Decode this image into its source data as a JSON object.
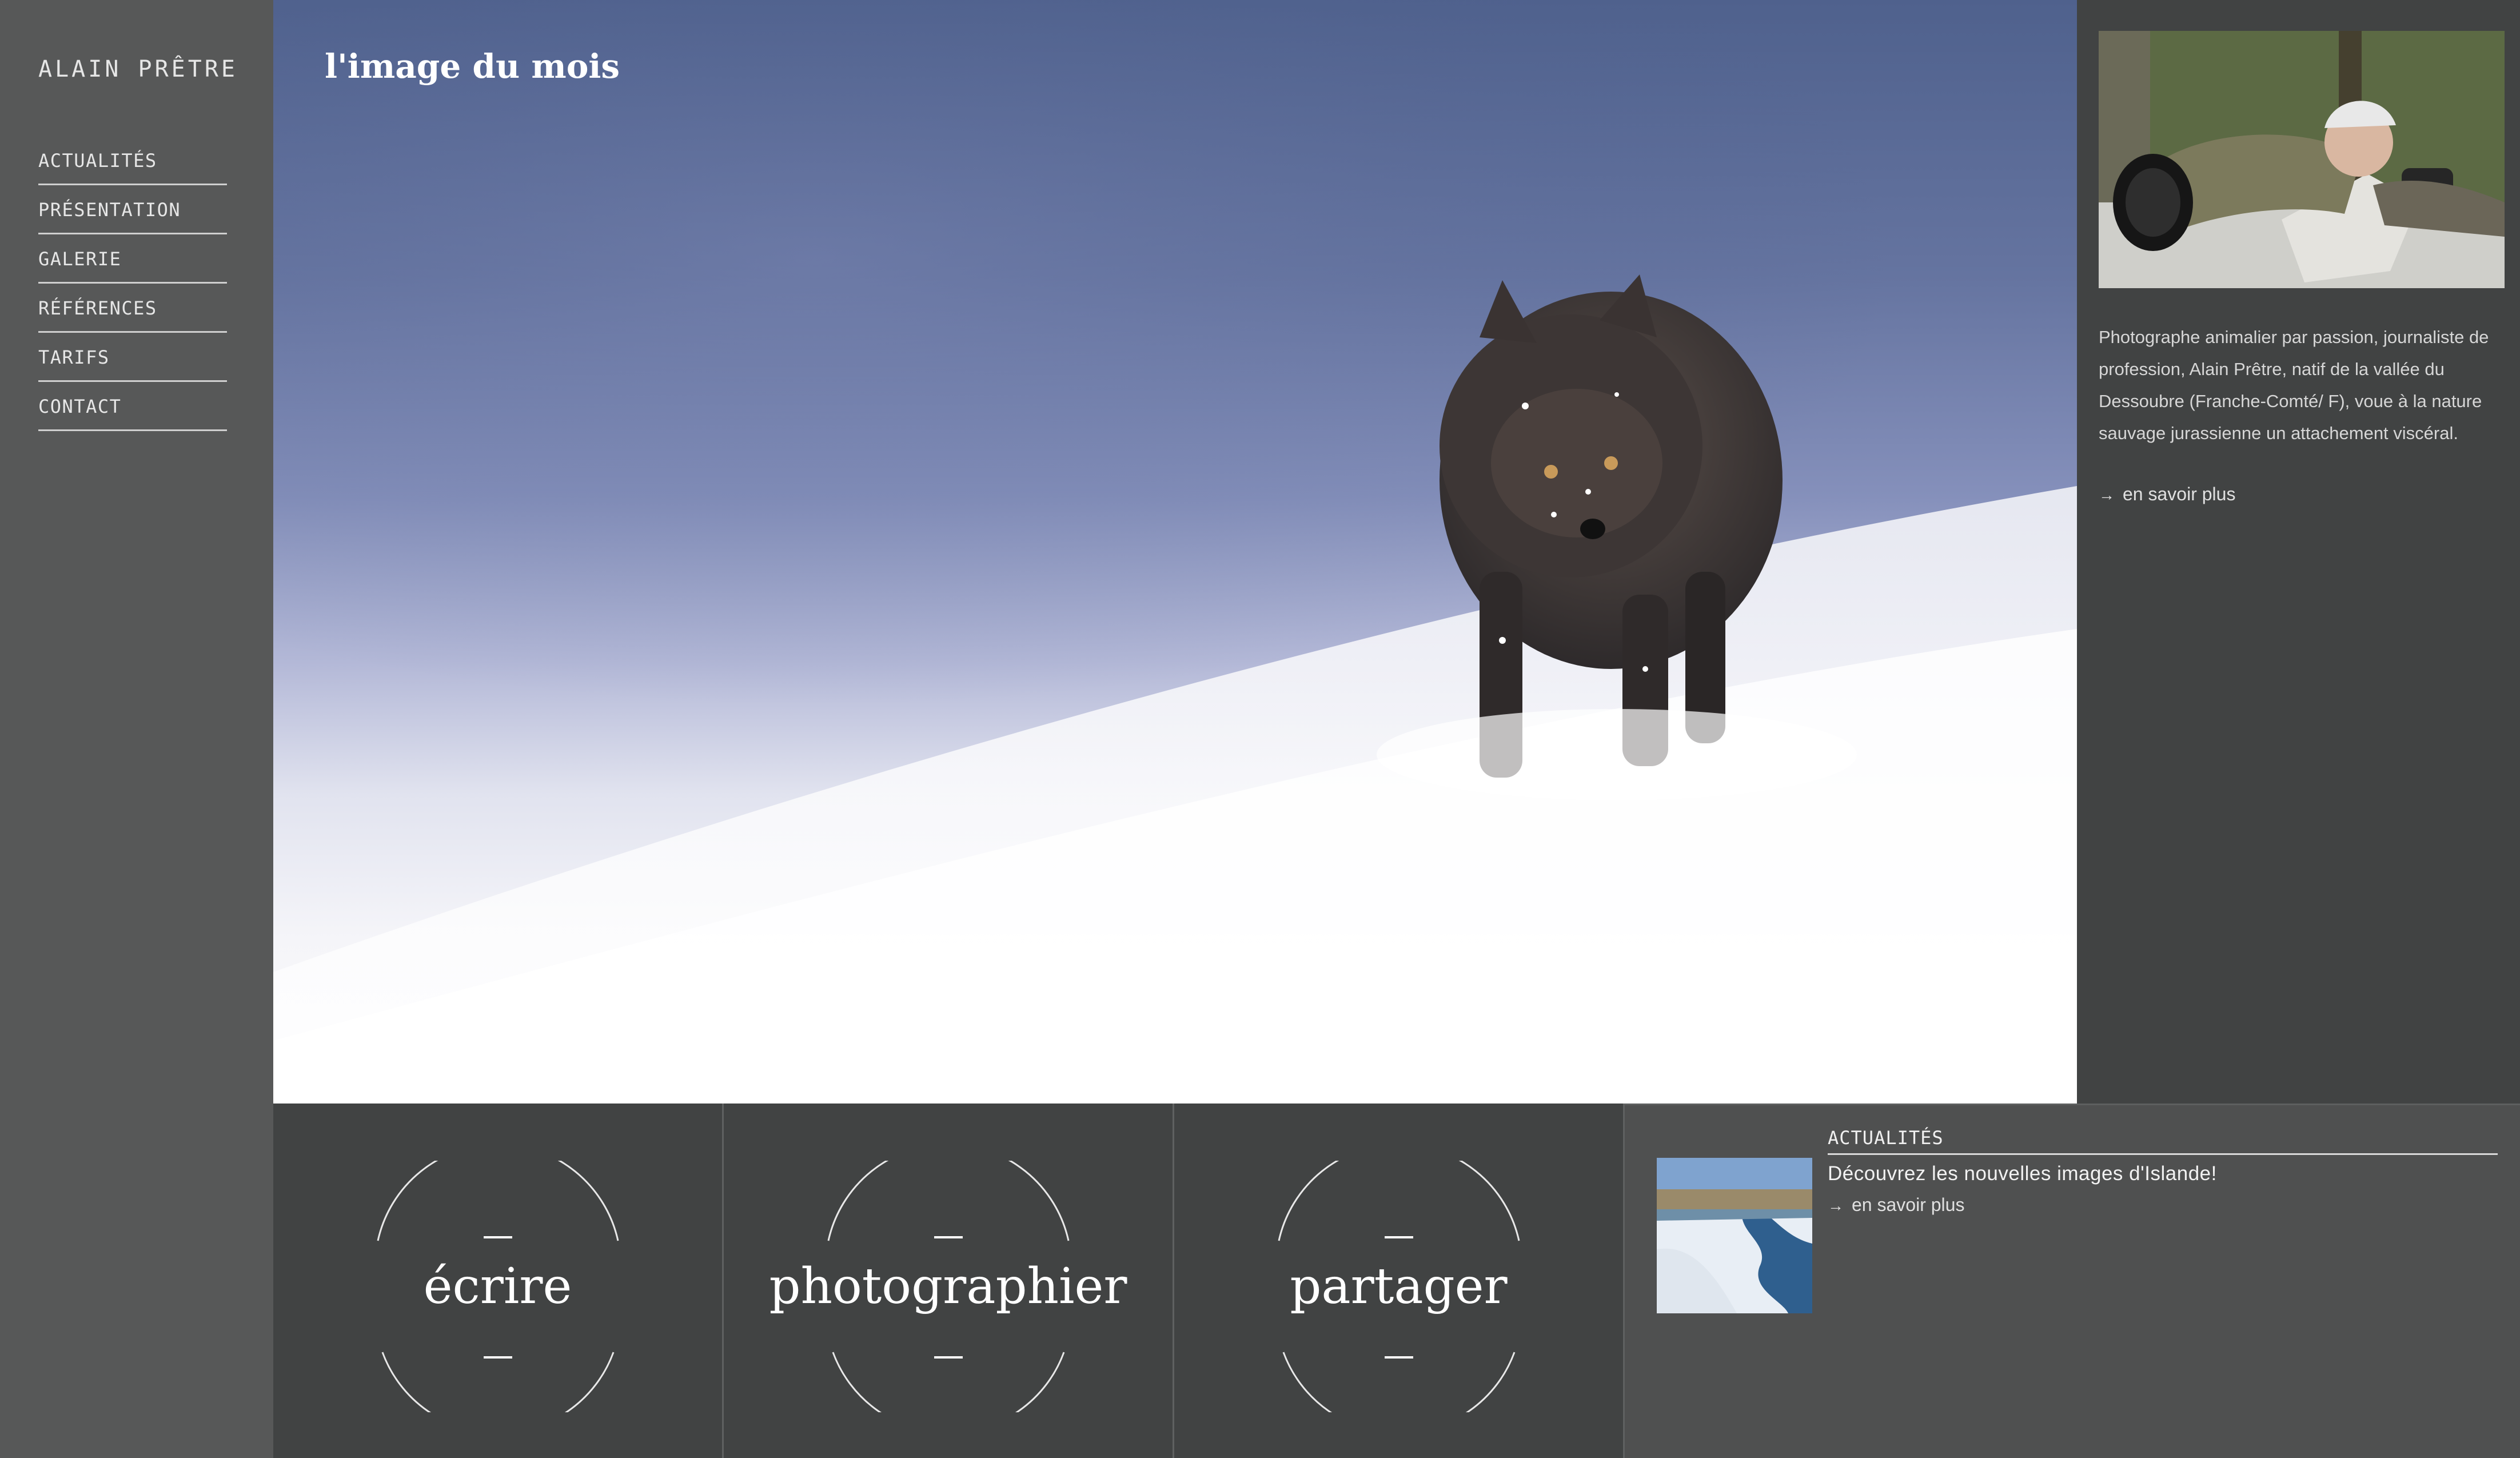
{
  "site": {
    "title": "ALAIN PRÊTRE"
  },
  "nav": {
    "items": [
      {
        "label": "ACTUALITÉS"
      },
      {
        "label": "PRÉSENTATION"
      },
      {
        "label": "GALERIE"
      },
      {
        "label": "RÉFÉRENCES"
      },
      {
        "label": "TARIFS"
      },
      {
        "label": "CONTACT"
      }
    ]
  },
  "hero": {
    "title": "l'image du mois",
    "image_icon": "arctic-fox-photo"
  },
  "about": {
    "portrait_icon": "photographer-portrait",
    "bio": "Photographe animalier par passion, journaliste de profession,  Alain Prêtre, natif de la vallée du Dessoubre (Franche-Comté/ F),  voue à la nature sauvage jurassienne un attachement viscéral.",
    "more_label": "en savoir plus",
    "arrow_icon": "arrow-right-icon"
  },
  "tiles": [
    {
      "label": "écrire"
    },
    {
      "label": "photographier"
    },
    {
      "label": "partager"
    }
  ],
  "news": {
    "heading": "ACTUALITÉS",
    "title": "Découvrez les nouvelles images d'Islande!",
    "more_label": "en savoir plus",
    "thumb_icon": "iceland-river-thumbnail"
  },
  "colors": {
    "sidebar": "#575858",
    "panel": "#414343",
    "background": "#4f5050",
    "text": "#e6e6e6"
  }
}
